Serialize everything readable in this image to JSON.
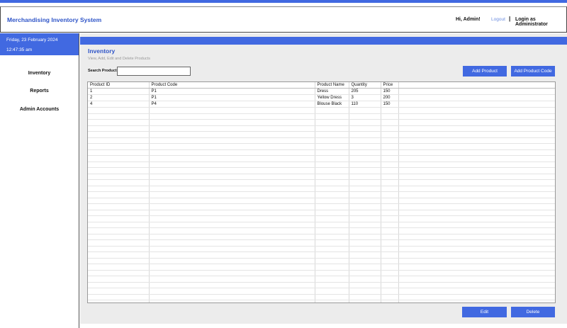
{
  "header": {
    "app_title": "Merchandising Inventory System",
    "greeting": "Hi, Admin!",
    "logout_label": "Logout",
    "separator": "|",
    "login_as": "Login as Administrator"
  },
  "sidebar": {
    "date": "Friday, 23 February 2024",
    "time": "12:47:35 am",
    "items": [
      {
        "label": "Inventory"
      },
      {
        "label": "Reports"
      },
      {
        "label": "Admin Accounts"
      }
    ]
  },
  "main": {
    "title": "Inventory",
    "subtitle": "View, Add, Edit and Delete Products",
    "search_label": "Search Product",
    "search_value": "",
    "add_product_label": "Add Product",
    "add_product_code_label": "Add Product Code",
    "edit_label": "Edit",
    "delete_label": "Delete",
    "table": {
      "columns": [
        "Product ID",
        "Product Code",
        "Product Name",
        "Quantity",
        "Price",
        ""
      ],
      "rows": [
        [
          "1",
          "P1",
          "Dress",
          "205",
          "150",
          ""
        ],
        [
          "2",
          "P1",
          "Yellow Dress",
          "3",
          "200",
          ""
        ],
        [
          "4",
          "P4",
          "Blouse Black",
          "110",
          "150",
          ""
        ]
      ],
      "empty_row_count": 33
    }
  },
  "colors": {
    "accent": "#4169e1",
    "title_blue": "#2f55c8",
    "panel_gray": "#ececec"
  }
}
